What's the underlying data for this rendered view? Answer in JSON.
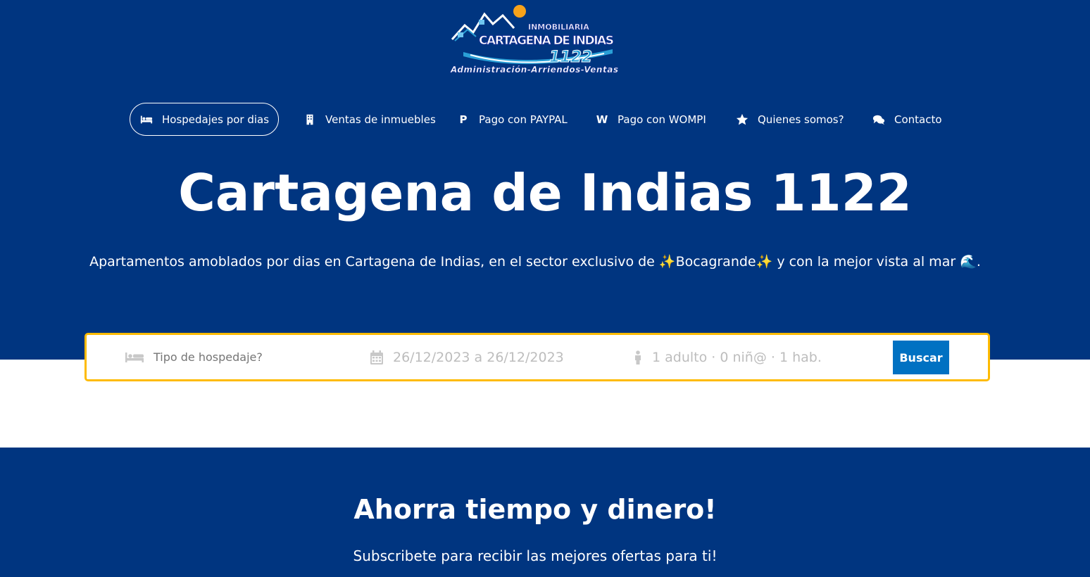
{
  "logo": {
    "line1": "INMOBILIARIA",
    "line2": "CARTAGENA DE INDIAS",
    "line3": "1122",
    "line4": "Administración-Arriendos-Ventas"
  },
  "nav": [
    {
      "label": "Hospedajes por dias",
      "icon": "bed-icon",
      "glyph": ""
    },
    {
      "label": "Ventas de inmuebles",
      "icon": "building-icon",
      "glyph": ""
    },
    {
      "label": "Pago con PAYPAL",
      "icon": "paypal-icon",
      "glyph": "P"
    },
    {
      "label": "Pago con WOMPI",
      "icon": "wompi-icon",
      "glyph": "W"
    },
    {
      "label": "Quienes somos?",
      "icon": "star-icon",
      "glyph": ""
    },
    {
      "label": "Contacto",
      "icon": "chat-icon",
      "glyph": ""
    }
  ],
  "hero": {
    "title": "Cartagena de Indias 1122",
    "subtitle": "Apartamentos amoblados por dias en Cartagena de Indias, en el sector exclusivo de ✨Bocagrande✨ y con la mejor vista al mar 🌊."
  },
  "search": {
    "type_placeholder": "Tipo de hospedaje?",
    "dates": "26/12/2023 a 26/12/2023",
    "guests": "1 adulto · 0 niñ@ · 1 hab.",
    "button": "Buscar"
  },
  "newsletter": {
    "title": "Ahorra tiempo y dinero!",
    "subtitle": "Subscribete para recibir las mejores ofertas para ti!"
  },
  "colors": {
    "primary": "#003580",
    "accent": "#febb02",
    "button": "#0071c2"
  }
}
